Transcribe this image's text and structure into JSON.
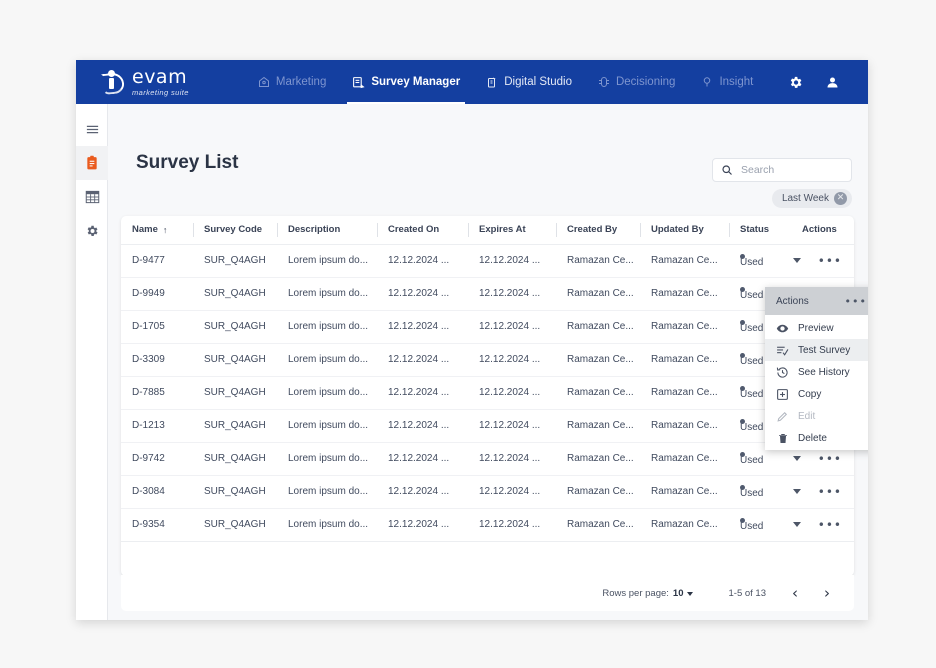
{
  "brand": {
    "logo_name": "evam",
    "logo_sub": "marketing suite",
    "nav_color": "#143fa0",
    "accent_color": "#ea5b1e"
  },
  "topnav": {
    "items": [
      {
        "label": "Marketing",
        "icon": "marketing-icon",
        "active": false
      },
      {
        "label": "Survey Manager",
        "icon": "survey-manager-icon",
        "active": true
      },
      {
        "label": "Digital Studio",
        "icon": "digital-studio-icon",
        "active": false
      },
      {
        "label": "Decisioning",
        "icon": "decisioning-icon",
        "active": false
      },
      {
        "label": "Insight",
        "icon": "insight-icon",
        "active": false
      }
    ],
    "right_icons": [
      {
        "name": "settings-gear-icon"
      },
      {
        "name": "user-account-icon"
      }
    ]
  },
  "rail": {
    "items": [
      {
        "name": "menu-hamburger-icon",
        "active": false
      },
      {
        "name": "survey-clipboard-icon",
        "active": true
      },
      {
        "name": "data-table-icon",
        "active": false
      },
      {
        "name": "settings-gear-icon",
        "active": false
      }
    ]
  },
  "page": {
    "title": "Survey List"
  },
  "search": {
    "placeholder": "Search",
    "value": "",
    "icon": "search-icon",
    "filter_icon": "filter-icon"
  },
  "filter_chip": {
    "label": "Last Week",
    "remove_icon": "close-icon",
    "remove_glyph": "✕"
  },
  "table": {
    "columns": [
      {
        "key": "name",
        "label": "Name",
        "sorted": true,
        "sort_glyph": "↑"
      },
      {
        "key": "survey_code",
        "label": "Survey Code"
      },
      {
        "key": "description",
        "label": "Description"
      },
      {
        "key": "created_on",
        "label": "Created On"
      },
      {
        "key": "expires_at",
        "label": "Expires At"
      },
      {
        "key": "created_by",
        "label": "Created By"
      },
      {
        "key": "updated_by",
        "label": "Updated By"
      },
      {
        "key": "status",
        "label": "Status"
      },
      {
        "key": "actions",
        "label": "Actions"
      }
    ],
    "rows": [
      {
        "name": "D-9477",
        "survey_code": "SUR_Q4AGH",
        "description": "Lorem ipsum do...",
        "created_on": "12.12.2024 ...",
        "expires_at": "12.12.2024 ...",
        "created_by": "Ramazan Ce...",
        "updated_by": "Ramazan Ce...",
        "status": "Used"
      },
      {
        "name": "D-9949",
        "survey_code": "SUR_Q4AGH",
        "description": "Lorem ipsum do...",
        "created_on": "12.12.2024 ...",
        "expires_at": "12.12.2024 ...",
        "created_by": "Ramazan Ce...",
        "updated_by": "Ramazan Ce...",
        "status": "Used"
      },
      {
        "name": "D-1705",
        "survey_code": "SUR_Q4AGH",
        "description": "Lorem ipsum do...",
        "created_on": "12.12.2024 ...",
        "expires_at": "12.12.2024 ...",
        "created_by": "Ramazan Ce...",
        "updated_by": "Ramazan Ce...",
        "status": "Used"
      },
      {
        "name": "D-3309",
        "survey_code": "SUR_Q4AGH",
        "description": "Lorem ipsum do...",
        "created_on": "12.12.2024 ...",
        "expires_at": "12.12.2024 ...",
        "created_by": "Ramazan Ce...",
        "updated_by": "Ramazan Ce...",
        "status": "Used"
      },
      {
        "name": "D-7885",
        "survey_code": "SUR_Q4AGH",
        "description": "Lorem ipsum do...",
        "created_on": "12.12.2024 ...",
        "expires_at": "12.12.2024 ...",
        "created_by": "Ramazan Ce...",
        "updated_by": "Ramazan Ce...",
        "status": "Used"
      },
      {
        "name": "D-1213",
        "survey_code": "SUR_Q4AGH",
        "description": "Lorem ipsum do...",
        "created_on": "12.12.2024 ...",
        "expires_at": "12.12.2024 ...",
        "created_by": "Ramazan Ce...",
        "updated_by": "Ramazan Ce...",
        "status": "Used"
      },
      {
        "name": "D-9742",
        "survey_code": "SUR_Q4AGH",
        "description": "Lorem ipsum do...",
        "created_on": "12.12.2024 ...",
        "expires_at": "12.12.2024 ...",
        "created_by": "Ramazan Ce...",
        "updated_by": "Ramazan Ce...",
        "status": "Used"
      },
      {
        "name": "D-3084",
        "survey_code": "SUR_Q4AGH",
        "description": "Lorem ipsum do...",
        "created_on": "12.12.2024 ...",
        "expires_at": "12.12.2024 ...",
        "created_by": "Ramazan Ce...",
        "updated_by": "Ramazan Ce...",
        "status": "Used"
      },
      {
        "name": "D-9354",
        "survey_code": "SUR_Q4AGH",
        "description": "Lorem ipsum do...",
        "created_on": "12.12.2024 ...",
        "expires_at": "12.12.2024 ...",
        "created_by": "Ramazan Ce...",
        "updated_by": "Ramazan Ce...",
        "status": "Used"
      }
    ]
  },
  "pagination": {
    "rows_per_page_label": "Rows per page:",
    "rows_per_page_value": "10",
    "range": "1-5 of 13",
    "prev_glyph": "‹",
    "next_glyph": "›"
  },
  "actions_menu": {
    "header_title": "Actions",
    "header_dots": "•••",
    "items": [
      {
        "label": "Preview",
        "icon": "eye-icon",
        "disabled": false,
        "hovered": false
      },
      {
        "label": "Test Survey",
        "icon": "test-survey-icon",
        "disabled": false,
        "hovered": true
      },
      {
        "label": "See History",
        "icon": "history-clock-icon",
        "disabled": false,
        "hovered": false
      },
      {
        "label": "Copy",
        "icon": "copy-icon",
        "disabled": false,
        "hovered": false
      },
      {
        "label": "Edit",
        "icon": "edit-pencil-icon",
        "disabled": true,
        "hovered": false
      },
      {
        "label": "Delete",
        "icon": "trash-icon",
        "disabled": false,
        "hovered": false
      }
    ]
  },
  "row_actions": {
    "dots_glyph": "•••"
  }
}
